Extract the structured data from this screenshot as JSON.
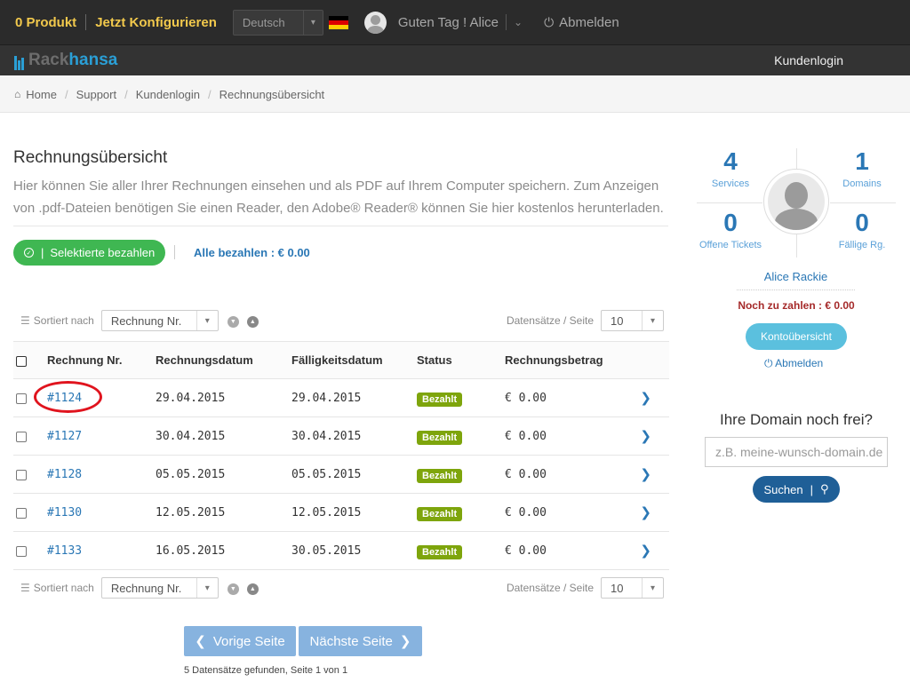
{
  "topbar": {
    "products": "0 Produkt",
    "configure": "Jetzt Konfigurieren",
    "language": "Deutsch",
    "flag_colors": [
      "#000000",
      "#dd0000",
      "#ffce00"
    ],
    "greeting": "Guten Tag ! Alice",
    "logout": "Abmelden"
  },
  "brand": {
    "logo_rack": "Rack",
    "logo_hansa": "hansa",
    "nav_login": "Kundenlogin",
    "accent": "#2a9fd6"
  },
  "breadcrumb": [
    "Home",
    "Support",
    "Kundenlogin",
    "Rechnungsübersicht"
  ],
  "main": {
    "title": "Rechnungsübersicht",
    "description": "Hier können Sie aller Ihrer Rechnungen einsehen und als PDF auf Ihrem Computer speichern. Zum Anzeigen von .pdf-Dateien benötigen Sie einen Reader, den Adobe® Reader® können Sie hier kostenlos herunterladen.",
    "pay_selected": "Selektierte bezahlen",
    "pay_all": "Alle bezahlen : € 0.00"
  },
  "sort": {
    "label": "Sortiert nach",
    "selected": "Rechnung Nr.",
    "records_label": "Datensätze / Seite",
    "records_value": "10"
  },
  "table": {
    "headers": [
      "Rechnung Nr.",
      "Rechnungsdatum",
      "Fälligkeitsdatum",
      "Status",
      "Rechnungsbetrag"
    ],
    "rows": [
      {
        "no": "#1124",
        "date": "29.04.2015",
        "due": "29.04.2015",
        "status": "Bezahlt",
        "amount": "€ 0.00"
      },
      {
        "no": "#1127",
        "date": "30.04.2015",
        "due": "30.04.2015",
        "status": "Bezahlt",
        "amount": "€ 0.00"
      },
      {
        "no": "#1128",
        "date": "05.05.2015",
        "due": "05.05.2015",
        "status": "Bezahlt",
        "amount": "€ 0.00"
      },
      {
        "no": "#1130",
        "date": "12.05.2015",
        "due": "12.05.2015",
        "status": "Bezahlt",
        "amount": "€ 0.00"
      },
      {
        "no": "#1133",
        "date": "16.05.2015",
        "due": "30.05.2015",
        "status": "Bezahlt",
        "amount": "€ 0.00"
      }
    ],
    "status_color": "#7ea50c"
  },
  "pagination": {
    "prev": "Vorige Seite",
    "next": "Nächste Seite",
    "info": "5 Datensätze gefunden, Seite 1 von 1"
  },
  "sidebar": {
    "services": {
      "count": "4",
      "label": "Services"
    },
    "domains": {
      "count": "1",
      "label": "Domains"
    },
    "tickets": {
      "count": "0",
      "label": "Offene Tickets"
    },
    "due_invoices": {
      "count": "0",
      "label": "Fällige Rg."
    },
    "user_name": "Alice Rackie",
    "amount_due": "Noch zu zahlen : € 0.00",
    "account_button": "Kontoübersicht",
    "logout": "Abmelden",
    "domain_question": "Ihre Domain noch frei?",
    "domain_placeholder": "z.B. meine-wunsch-domain.de",
    "search_button": "Suchen"
  }
}
